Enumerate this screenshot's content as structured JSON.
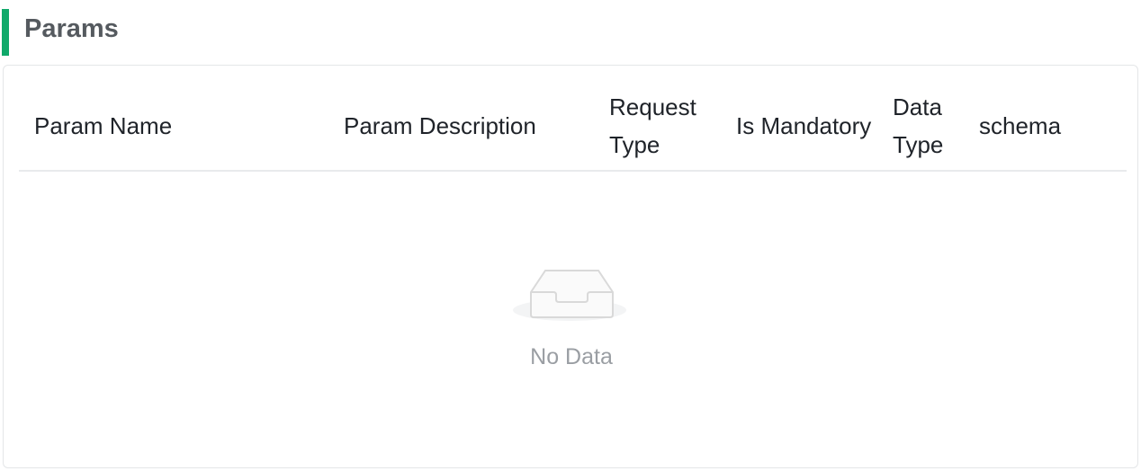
{
  "section": {
    "title": "Params",
    "accent_color": "#10a96a"
  },
  "table": {
    "columns": [
      {
        "label": "Param Name"
      },
      {
        "label": "Param Description"
      },
      {
        "label": "Request Type"
      },
      {
        "label": "Is Mandatory"
      },
      {
        "label": "Data Type"
      },
      {
        "label": "schema"
      }
    ],
    "rows": [],
    "empty": {
      "icon": "empty-inbox-icon",
      "text": "No Data"
    }
  }
}
